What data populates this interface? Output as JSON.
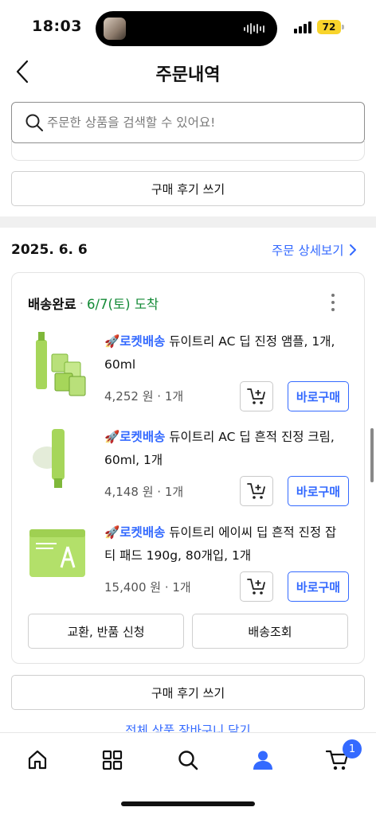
{
  "status_bar": {
    "time": "18:03",
    "battery": "72"
  },
  "header": {
    "title": "주문내역"
  },
  "search": {
    "placeholder": "주문한 상품을 검색할 수 있어요!"
  },
  "prev_order": {
    "review_button": "구매 후기 쓰기"
  },
  "order": {
    "date": "2025. 6. 6",
    "detail_link": "주문 상세보기",
    "status": "배송완료",
    "separator": "·",
    "arrival": "6/7(토) 도착",
    "items": [
      {
        "badge": "🚀로켓배송",
        "name": " 듀이트리 AC 딥 진정 앰플, 1개, 60ml",
        "price": "4,252 원",
        "qty": "1개",
        "buy_label": "바로구매"
      },
      {
        "badge": "🚀로켓배송",
        "name": " 듀이트리 AC 딥 흔적 진정 크림, 60ml, 1개",
        "price": "4,148 원",
        "qty": "1개",
        "buy_label": "바로구매"
      },
      {
        "badge": "🚀로켓배송",
        "name": " 듀이트리 에이씨 딥 흔적 진정 잡티 패드 190g, 80개입, 1개",
        "price": "15,400 원",
        "qty": "1개",
        "buy_label": "바로구매"
      }
    ],
    "exchange_button": "교환, 반품 신청",
    "tracking_button": "배송조회",
    "review_button": "구매 후기 쓰기",
    "cart_all_link": "전체 상품 장바구니 담기"
  },
  "tabbar": {
    "tabs": [
      "home-icon",
      "category-icon",
      "search-icon",
      "my-icon",
      "cart-icon"
    ],
    "cart_count": "1",
    "active": "my"
  },
  "colors": {
    "accent": "#346aff",
    "arrival": "#138a36",
    "product_green": "#a6d65a"
  }
}
